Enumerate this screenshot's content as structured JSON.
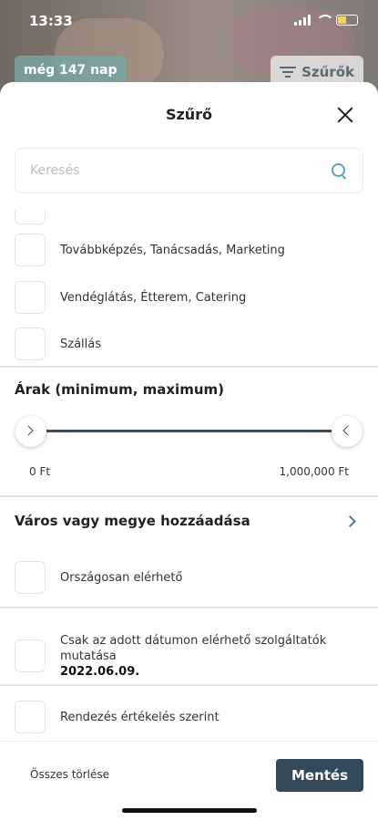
{
  "status": {
    "time": "13:33"
  },
  "background": {
    "days_badge": "még 147 nap",
    "filters_button": "Szűrők"
  },
  "sheet": {
    "title": "Szűrő"
  },
  "search": {
    "placeholder": "Keresés"
  },
  "categories": [
    {
      "label": "Továbbképzés, Tanácsadás, Marketing",
      "checked": false
    },
    {
      "label": "Vendéglátás, Étterem, Catering",
      "checked": false
    },
    {
      "label": "Szállás",
      "checked": false
    }
  ],
  "price": {
    "title": "Árak (minimum, maximum)",
    "min_label": "0 Ft",
    "max_label": "1,000,000 Ft"
  },
  "location": {
    "title": "Város vagy megye hozzáadása"
  },
  "options": {
    "nationwide": "Országosan elérhető",
    "date_only": "Csak az adott dátumon elérhető szolgáltatók mutatása",
    "date_value": "2022.06.09.",
    "sort_rating": "Rendezés értékelés szerint"
  },
  "footer": {
    "clear_all": "Összes törlése",
    "save": "Mentés"
  },
  "colors": {
    "accent": "#34495a",
    "teal": "#5aa3b8",
    "link": "#3a7ea3"
  }
}
